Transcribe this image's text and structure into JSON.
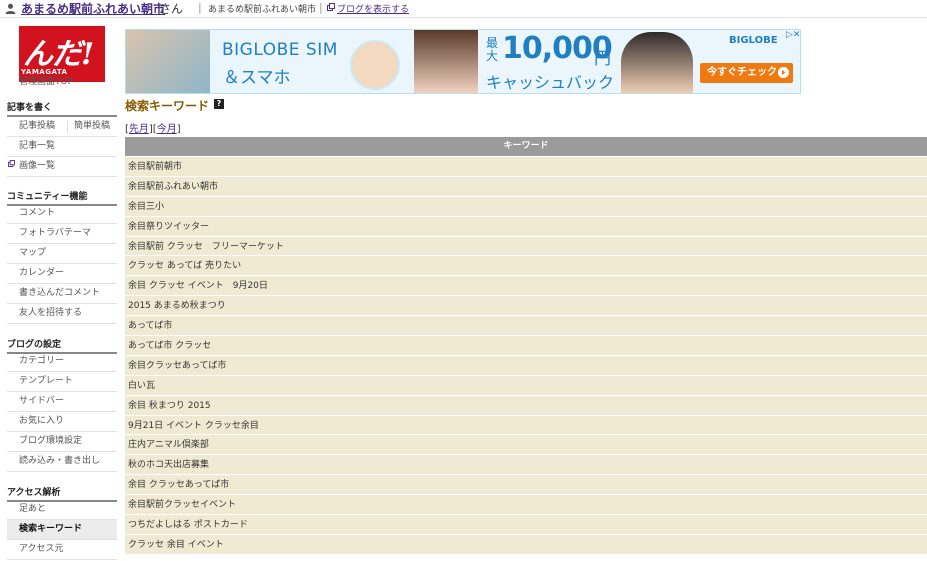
{
  "topbar": {
    "blog_owner": "あまるめ駅前ふれあい朝市",
    "honorific": "さん",
    "separator": "|",
    "blog_title": "あまるめ駅前ふれあい朝市",
    "show_blog": "ブログを表示する"
  },
  "sidebar": {
    "logo_text": "んだ!",
    "logo_sub": "YAMAGATA",
    "admin_top": "管理画面TOP",
    "sections": {
      "write": "記事を書く",
      "community": "コミュニティー機能",
      "settings": "ブログの設定",
      "analytics": "アクセス解析"
    },
    "write_items": {
      "post": "記事投稿",
      "simple_post": "簡単投稿",
      "list": "記事一覧",
      "images": "画像一覧"
    },
    "community_items": [
      "コメント",
      "フォトラバテーマ",
      "マップ",
      "カレンダー",
      "書き込んだコメント",
      "友人を招待する"
    ],
    "settings_items": [
      "カテゴリー",
      "テンプレート",
      "サイドバー",
      "お気に入り",
      "ブログ環境設定",
      "読み込み・書き出し"
    ],
    "analytics_items": [
      "足あと",
      "検索キーワード",
      "アクセス元"
    ]
  },
  "banner": {
    "sim": "BIGLOBE SIM",
    "sumaho": "＆スマホ",
    "max": "最大",
    "amount": "10,000",
    "yen": "円",
    "cashback": "キャッシュバック",
    "brand": "BIGLOBE",
    "ad_marks": "▷✕",
    "cta": "今すぐチェック"
  },
  "main": {
    "title": "検索キーワード",
    "help": "?",
    "period_open": "[",
    "last_month": "先月",
    "period_mid": "][",
    "this_month": "今月",
    "period_close": "]",
    "column_header": "キーワード",
    "keywords": [
      "余目駅前朝市",
      "余目駅前ふれあい朝市",
      "余目三小",
      "余目祭りツイッター",
      "余目駅前 クラッセ　フリーマーケット",
      "クラッセ あってば 売りたい",
      "余目 クラッセ イベント　9月20日",
      "2015 あまるめ秋まつり",
      "あってば市",
      "あってば市 クラッセ",
      "余目クラッセあってば市",
      "白い瓦",
      "余目 秋まつり 2015",
      "9月21日 イベント クラッセ余目",
      "庄内アニマル倶楽部",
      "秋のホコ天出店募集",
      "余目 クラッセあってば市",
      "余目駅前クラッセイベント",
      "つちだよしはる ポストカード",
      "クラッセ 余目 イベント"
    ]
  }
}
